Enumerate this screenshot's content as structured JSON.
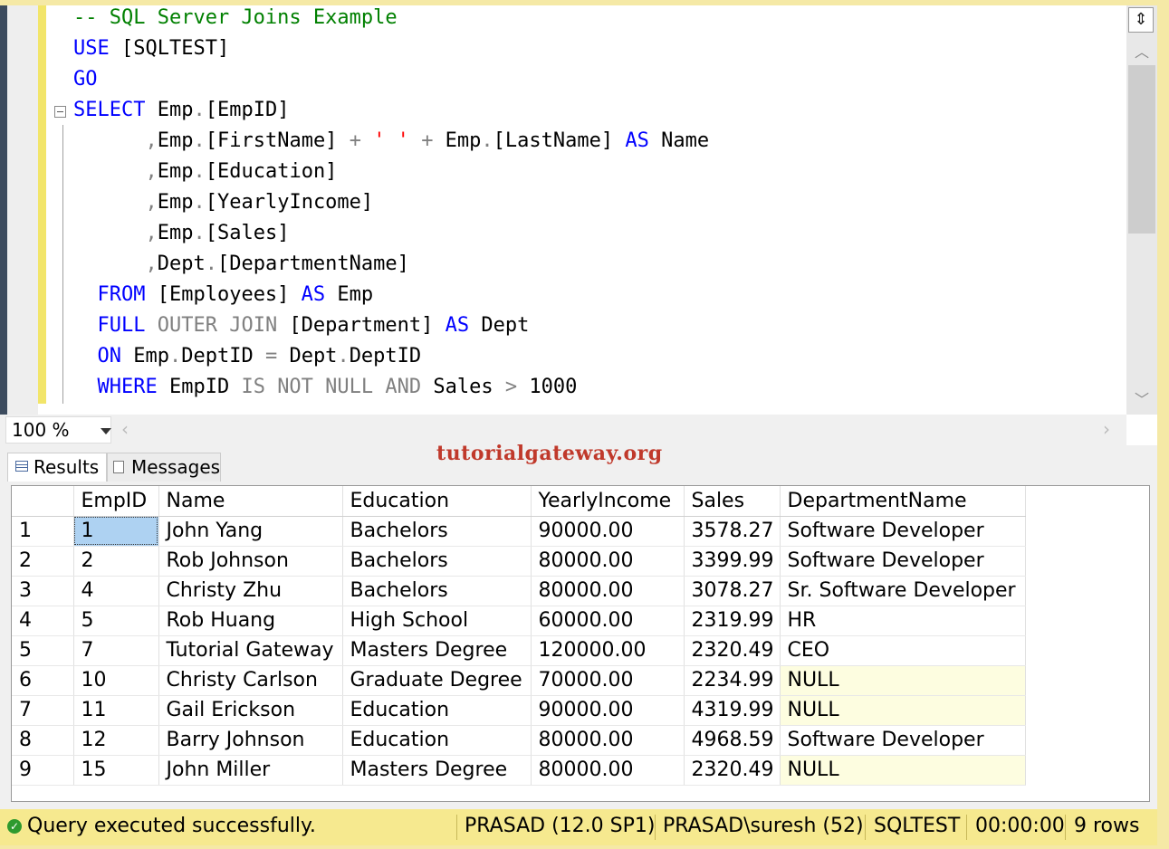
{
  "editor": {
    "lines": [
      {
        "tokens": [
          {
            "t": "-- SQL Server Joins Example",
            "c": "cm"
          }
        ]
      },
      {
        "tokens": [
          {
            "t": "USE",
            "c": "kw"
          },
          {
            "t": " [SQLTEST]",
            "c": ""
          }
        ]
      },
      {
        "tokens": [
          {
            "t": "GO",
            "c": "kw"
          }
        ]
      },
      {
        "tokens": [
          {
            "t": "SELECT",
            "c": "kw"
          },
          {
            "t": " Emp",
            "c": ""
          },
          {
            "t": ".",
            "c": "gr"
          },
          {
            "t": "[EmpID]",
            "c": ""
          }
        ]
      },
      {
        "tokens": [
          {
            "t": "      ",
            "c": ""
          },
          {
            "t": ",",
            "c": "gr"
          },
          {
            "t": "Emp",
            "c": ""
          },
          {
            "t": ".",
            "c": "gr"
          },
          {
            "t": "[FirstName] ",
            "c": ""
          },
          {
            "t": "+",
            "c": "gr"
          },
          {
            "t": " ",
            "c": ""
          },
          {
            "t": "' '",
            "c": "str"
          },
          {
            "t": " ",
            "c": ""
          },
          {
            "t": "+",
            "c": "gr"
          },
          {
            "t": " Emp",
            "c": ""
          },
          {
            "t": ".",
            "c": "gr"
          },
          {
            "t": "[LastName] ",
            "c": ""
          },
          {
            "t": "AS",
            "c": "kw"
          },
          {
            "t": " Name",
            "c": ""
          }
        ]
      },
      {
        "tokens": [
          {
            "t": "      ",
            "c": ""
          },
          {
            "t": ",",
            "c": "gr"
          },
          {
            "t": "Emp",
            "c": ""
          },
          {
            "t": ".",
            "c": "gr"
          },
          {
            "t": "[Education]",
            "c": ""
          }
        ]
      },
      {
        "tokens": [
          {
            "t": "      ",
            "c": ""
          },
          {
            "t": ",",
            "c": "gr"
          },
          {
            "t": "Emp",
            "c": ""
          },
          {
            "t": ".",
            "c": "gr"
          },
          {
            "t": "[YearlyIncome]",
            "c": ""
          }
        ]
      },
      {
        "tokens": [
          {
            "t": "      ",
            "c": ""
          },
          {
            "t": ",",
            "c": "gr"
          },
          {
            "t": "Emp",
            "c": ""
          },
          {
            "t": ".",
            "c": "gr"
          },
          {
            "t": "[Sales]",
            "c": ""
          }
        ]
      },
      {
        "tokens": [
          {
            "t": "      ",
            "c": ""
          },
          {
            "t": ",",
            "c": "gr"
          },
          {
            "t": "Dept",
            "c": ""
          },
          {
            "t": ".",
            "c": "gr"
          },
          {
            "t": "[DepartmentName]",
            "c": ""
          }
        ]
      },
      {
        "tokens": [
          {
            "t": "  ",
            "c": ""
          },
          {
            "t": "FROM",
            "c": "kw"
          },
          {
            "t": " [Employees] ",
            "c": ""
          },
          {
            "t": "AS",
            "c": "kw"
          },
          {
            "t": " Emp",
            "c": ""
          }
        ]
      },
      {
        "tokens": [
          {
            "t": "  ",
            "c": ""
          },
          {
            "t": "FULL",
            "c": "kw"
          },
          {
            "t": " ",
            "c": ""
          },
          {
            "t": "OUTER JOIN",
            "c": "gr"
          },
          {
            "t": " [Department] ",
            "c": ""
          },
          {
            "t": "AS",
            "c": "kw"
          },
          {
            "t": " Dept",
            "c": ""
          }
        ]
      },
      {
        "tokens": [
          {
            "t": "  ",
            "c": ""
          },
          {
            "t": "ON",
            "c": "kw"
          },
          {
            "t": " Emp",
            "c": ""
          },
          {
            "t": ".",
            "c": "gr"
          },
          {
            "t": "DeptID ",
            "c": ""
          },
          {
            "t": "=",
            "c": "gr"
          },
          {
            "t": " Dept",
            "c": ""
          },
          {
            "t": ".",
            "c": "gr"
          },
          {
            "t": "DeptID",
            "c": ""
          }
        ]
      },
      {
        "tokens": [
          {
            "t": "  ",
            "c": ""
          },
          {
            "t": "WHERE",
            "c": "kw"
          },
          {
            "t": " EmpID ",
            "c": ""
          },
          {
            "t": "IS NOT NULL AND",
            "c": "gr"
          },
          {
            "t": " Sales ",
            "c": ""
          },
          {
            "t": ">",
            "c": "gr"
          },
          {
            "t": " 1000",
            "c": ""
          }
        ]
      }
    ]
  },
  "zoom": {
    "value": "100 %"
  },
  "tabs": {
    "results": "Results",
    "messages": "Messages"
  },
  "watermark": "tutorialgateway.org",
  "grid": {
    "columns": [
      "",
      "EmpID",
      "Name",
      "Education",
      "YearlyIncome",
      "Sales",
      "DepartmentName"
    ],
    "rows": [
      [
        "1",
        "1",
        "John Yang",
        "Bachelors",
        "90000.00",
        "3578.27",
        "Software Developer"
      ],
      [
        "2",
        "2",
        "Rob Johnson",
        "Bachelors",
        "80000.00",
        "3399.99",
        "Software Developer"
      ],
      [
        "3",
        "4",
        "Christy Zhu",
        "Bachelors",
        "80000.00",
        "3078.27",
        "Sr. Software Developer"
      ],
      [
        "4",
        "5",
        "Rob Huang",
        "High School",
        "60000.00",
        "2319.99",
        "HR"
      ],
      [
        "5",
        "7",
        "Tutorial Gateway",
        "Masters Degree",
        "120000.00",
        "2320.49",
        "CEO"
      ],
      [
        "6",
        "10",
        "Christy Carlson",
        "Graduate Degree",
        "70000.00",
        "2234.99",
        "NULL"
      ],
      [
        "7",
        "11",
        "Gail Erickson",
        "Education",
        "90000.00",
        "4319.99",
        "NULL"
      ],
      [
        "8",
        "12",
        "Barry Johnson",
        "Education",
        "80000.00",
        "4968.59",
        "Software Developer"
      ],
      [
        "9",
        "15",
        "John Miller",
        "Masters Degree",
        "80000.00",
        "2320.49",
        "NULL"
      ]
    ]
  },
  "status": {
    "message": "Query executed successfully.",
    "server": "PRASAD (12.0 SP1)",
    "user": "PRASAD\\suresh (52)",
    "database": "SQLTEST",
    "elapsed": "00:00:00",
    "rows": "9 rows"
  }
}
